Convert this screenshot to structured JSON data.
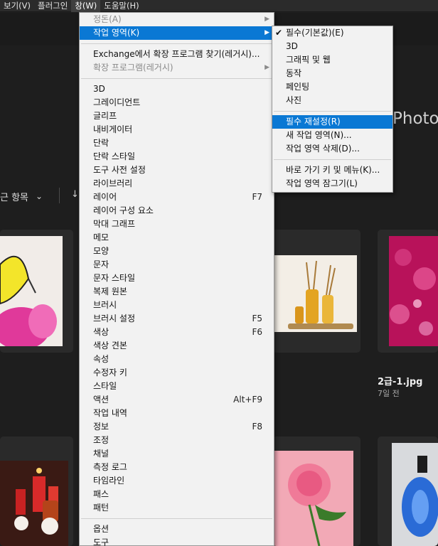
{
  "menubar": {
    "items": [
      {
        "label": "보기(V)",
        "active": false
      },
      {
        "label": "플러그인",
        "active": false
      },
      {
        "label": "창(W)",
        "active": true
      },
      {
        "label": "도움말(H)",
        "active": false
      }
    ]
  },
  "background": {
    "photo_title": "Photo",
    "sort_label": "근 항목",
    "sort_chevron": "⌄",
    "sort_arrow": "↓",
    "file_name": "2급-1.jpg",
    "file_date": "7일 전"
  },
  "window_menu": {
    "items": [
      {
        "label": "정돈(A)",
        "disabled": true,
        "submenu": true
      },
      {
        "label": "작업 영역(K)",
        "highlight": true,
        "submenu": true
      },
      {
        "sep": true
      },
      {
        "label": "Exchange에서 확장 프로그램 찾기(레거시)..."
      },
      {
        "label": "확장 프로그램(레거시)",
        "disabled": true,
        "submenu": true
      },
      {
        "sep": true
      },
      {
        "label": "3D"
      },
      {
        "label": "그레이디언트"
      },
      {
        "label": "글리프"
      },
      {
        "label": "내비게이터"
      },
      {
        "label": "단락"
      },
      {
        "label": "단락 스타일"
      },
      {
        "label": "도구 사전 설정"
      },
      {
        "label": "라이브러리"
      },
      {
        "label": "레이어",
        "shortcut": "F7"
      },
      {
        "label": "레이어 구성 요소"
      },
      {
        "label": "막대 그래프"
      },
      {
        "label": "메모"
      },
      {
        "label": "모양"
      },
      {
        "label": "문자"
      },
      {
        "label": "문자 스타일"
      },
      {
        "label": "복제 원본"
      },
      {
        "label": "브러시"
      },
      {
        "label": "브러시 설정",
        "shortcut": "F5"
      },
      {
        "label": "색상",
        "shortcut": "F6"
      },
      {
        "label": "색상 견본"
      },
      {
        "label": "속성"
      },
      {
        "label": "수정자 키"
      },
      {
        "label": "스타일"
      },
      {
        "label": "액션",
        "shortcut": "Alt+F9"
      },
      {
        "label": "작업 내역"
      },
      {
        "label": "정보",
        "shortcut": "F8"
      },
      {
        "label": "조정"
      },
      {
        "label": "채널"
      },
      {
        "label": "측정 로그"
      },
      {
        "label": "타임라인"
      },
      {
        "label": "패스"
      },
      {
        "label": "패턴"
      },
      {
        "sep": true
      },
      {
        "label": "옵션"
      },
      {
        "label": "도구"
      }
    ]
  },
  "workspace_menu": {
    "items": [
      {
        "label": "필수(기본값)(E)",
        "checked": true
      },
      {
        "label": "3D"
      },
      {
        "label": "그래픽 및 웹"
      },
      {
        "label": "동작"
      },
      {
        "label": "페인팅"
      },
      {
        "label": "사진"
      },
      {
        "sep": true
      },
      {
        "label": "필수 재설정(R)",
        "highlight": true
      },
      {
        "label": "새 작업 영역(N)..."
      },
      {
        "label": "작업 영역 삭제(D)..."
      },
      {
        "sep": true
      },
      {
        "label": "바로 가기 키 및 메뉴(K)..."
      },
      {
        "label": "작업 영역 잠그기(L)"
      }
    ]
  },
  "colors": {
    "highlight": "#0a78d4",
    "menu_bg": "#f2f2f2",
    "app_bg": "#1e1e1e"
  }
}
